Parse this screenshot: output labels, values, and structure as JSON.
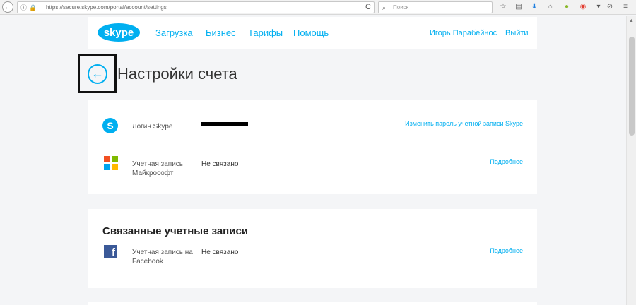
{
  "browser": {
    "url": "https://secure.skype.com/portal/account/settings",
    "search_placeholder": "Поиск",
    "reload_glyph": "C"
  },
  "header": {
    "logo_text": "skype",
    "nav": [
      "Загрузка",
      "Бизнес",
      "Тарифы",
      "Помощь"
    ],
    "user_name": "Игорь Парабейнос",
    "sign_out": "Выйти"
  },
  "page": {
    "title": "Настройки счета"
  },
  "account_card": {
    "rows": [
      {
        "label": "Логин Skype",
        "value": "",
        "link": "Изменить пароль учетной записи Skype",
        "icon": "skype-icon"
      },
      {
        "label": "Учетная запись Майкрософт",
        "value": "Не связано",
        "link": "Подробнее",
        "icon": "microsoft-icon"
      }
    ]
  },
  "linked_card": {
    "title": "Связанные учетные записи",
    "rows": [
      {
        "label": "Учетная запись на Facebook",
        "value": "Не связано",
        "link": "Подробнее",
        "icon": "facebook-icon"
      }
    ]
  },
  "colors": {
    "accent": "#00aff0",
    "facebook": "#3b5998",
    "ms_red": "#f25022",
    "ms_green": "#7fba00",
    "ms_blue": "#00a4ef",
    "ms_yellow": "#ffb900"
  }
}
